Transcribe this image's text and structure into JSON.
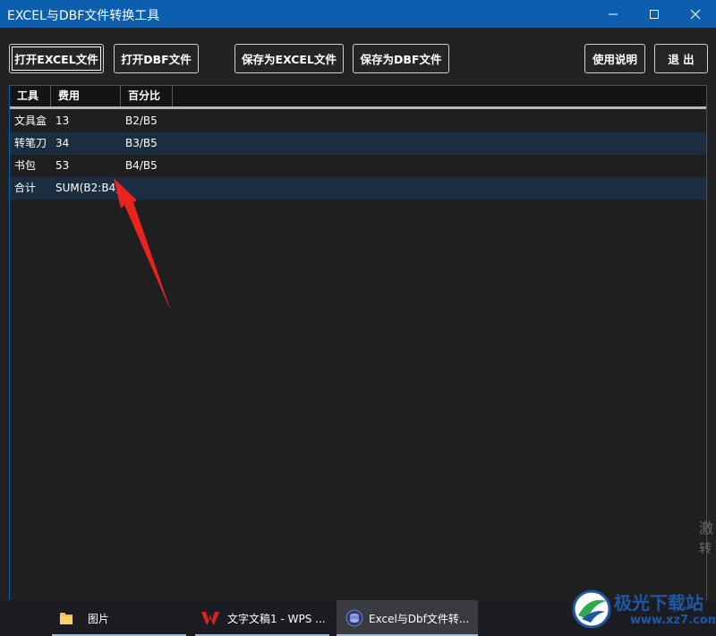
{
  "window": {
    "title": "EXCEL与DBF文件转换工具"
  },
  "toolbar": {
    "open_excel": "打开EXCEL文件",
    "open_dbf": "打开DBF文件",
    "save_excel": "保存为EXCEL文件",
    "save_dbf": "保存为DBF文件",
    "help": "使用说明",
    "exit": "退 出"
  },
  "table": {
    "headers": [
      "工具",
      "费用",
      "百分比"
    ],
    "rows": [
      [
        "文具盒",
        "13",
        "B2/B5"
      ],
      [
        "转笔刀",
        "34",
        "B3/B5"
      ],
      [
        "书包",
        "53",
        "B4/B5"
      ],
      [
        "合计",
        "SUM(B2:B4)",
        ""
      ]
    ]
  },
  "activation_watermark": {
    "line1": "激",
    "line2": "转"
  },
  "taskbar": {
    "items": [
      {
        "label": "图片",
        "icon": "folder-icon"
      },
      {
        "label": "文字文稿1 - WPS ...",
        "icon": "wps-icon"
      },
      {
        "label": "Excel与Dbf文件转...",
        "icon": "app-icon",
        "active": true
      }
    ]
  },
  "site_logo": {
    "name": "极光下载站",
    "url": "www.xz7.com"
  },
  "colors": {
    "accent": "#0b5fae",
    "arrow": "#e8241c",
    "row_alt": "#1b2e40"
  }
}
